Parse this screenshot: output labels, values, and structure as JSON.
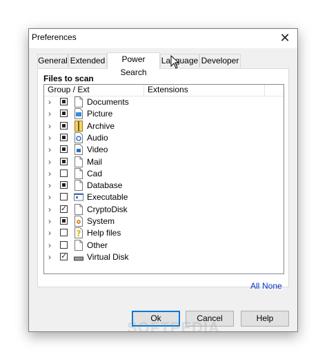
{
  "window": {
    "title": "Preferences",
    "close_glyph": "✕"
  },
  "tabs": [
    {
      "label": "General"
    },
    {
      "label": "Extended"
    },
    {
      "label": "Power Search",
      "active": true
    },
    {
      "label": "Language"
    },
    {
      "label": "Developer"
    }
  ],
  "files_to_scan": {
    "label": "Files to scan",
    "columns": [
      "Group / Ext",
      "Extensions"
    ],
    "rows": [
      {
        "label": "Documents",
        "check": "partial",
        "icon": "document-icon"
      },
      {
        "label": "Picture",
        "check": "partial",
        "icon": "picture-icon"
      },
      {
        "label": "Archive",
        "check": "partial",
        "icon": "archive-icon"
      },
      {
        "label": "Audio",
        "check": "partial",
        "icon": "audio-icon"
      },
      {
        "label": "Video",
        "check": "partial",
        "icon": "video-icon"
      },
      {
        "label": "Mail",
        "check": "partial",
        "icon": "document-icon"
      },
      {
        "label": "Cad",
        "check": "unchecked",
        "icon": "document-icon"
      },
      {
        "label": "Database",
        "check": "partial",
        "icon": "document-icon"
      },
      {
        "label": "Executable",
        "check": "unchecked",
        "icon": "executable-icon"
      },
      {
        "label": "CryptoDisk",
        "check": "checked",
        "icon": "document-icon"
      },
      {
        "label": "System",
        "check": "partial",
        "icon": "system-icon"
      },
      {
        "label": "Help files",
        "check": "unchecked",
        "icon": "help-icon"
      },
      {
        "label": "Other",
        "check": "unchecked",
        "icon": "document-icon"
      },
      {
        "label": "Virtual Disk",
        "check": "checked",
        "icon": "disk-icon"
      }
    ]
  },
  "links": {
    "all": "All",
    "none": "None"
  },
  "buttons": {
    "ok": "Ok",
    "cancel": "Cancel",
    "help": "Help"
  },
  "watermark": "SOFTPEDIA",
  "colors": {
    "link": "#0033cc",
    "default_button_border": "#0078d7"
  }
}
